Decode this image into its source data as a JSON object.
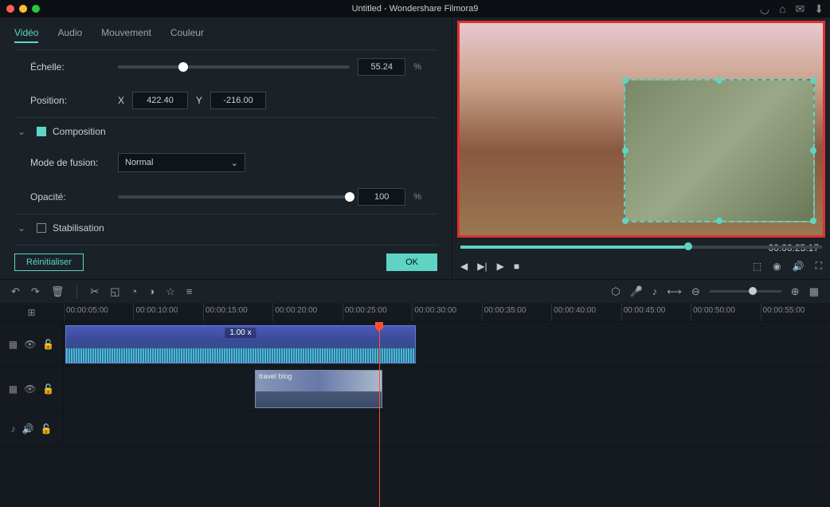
{
  "window": {
    "title": "Untitled - Wondershare Filmora9"
  },
  "tabs": {
    "video": "Vidéo",
    "audio": "Audio",
    "motion": "Mouvement",
    "color": "Couleur"
  },
  "props": {
    "scale_label": "Échelle:",
    "scale_value": "55.24",
    "scale_pct": 55.24,
    "position_label": "Position:",
    "x_label": "X",
    "x_value": "422.40",
    "y_label": "Y",
    "y_value": "-216.00",
    "composition_label": "Composition",
    "blend_label": "Mode de fusion:",
    "blend_value": "Normal",
    "opacity_label": "Opacité:",
    "opacity_value": "100",
    "opacity_pct": 100,
    "stabilization_label": "Stabilisation"
  },
  "buttons": {
    "reset": "Réinitialiser",
    "ok": "OK"
  },
  "preview": {
    "timecode": "00:00:25:17"
  },
  "timeline": {
    "ticks": [
      "00:00:05:00",
      "00:00:10:00",
      "00:00:15:00",
      "00:00:20:00",
      "00:00:25:00",
      "00:00:30:00",
      "00:00:35:00",
      "00:00:40:00",
      "00:00:45:00",
      "00:00:50:00",
      "00:00:55:00"
    ],
    "clip1_speed": "1.00 x",
    "clip2_label": "travel blog",
    "playhead_pct": 40
  },
  "pct_symbol": "%"
}
